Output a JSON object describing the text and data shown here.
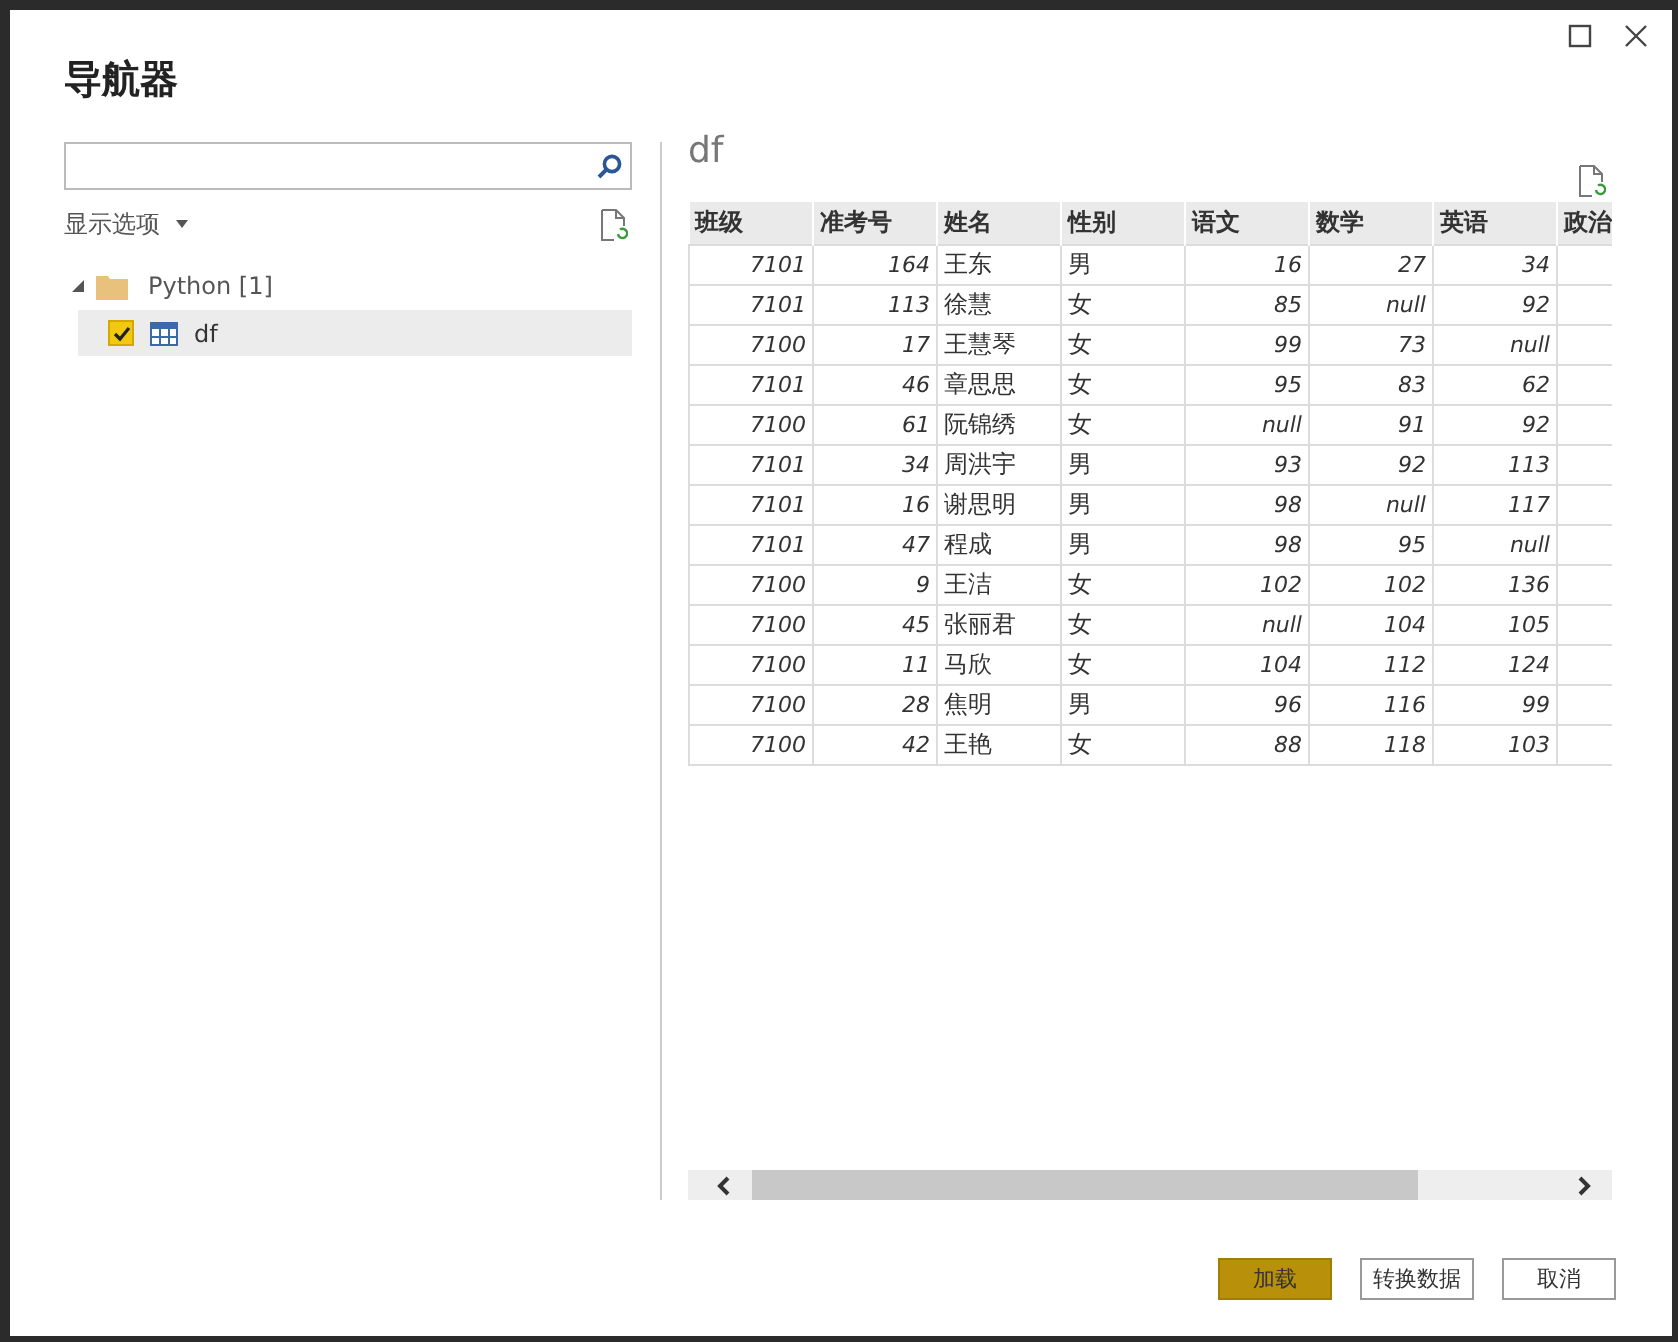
{
  "window": {
    "title": "导航器"
  },
  "display_options": {
    "label": "显示选项"
  },
  "tree": [
    {
      "label": "Python [1]",
      "expanded": true,
      "children": [
        {
          "label": "df",
          "checked": true,
          "selected": true
        }
      ]
    }
  ],
  "preview": {
    "title": "df",
    "columns": [
      {
        "label": "班级",
        "kind": "number"
      },
      {
        "label": "准考号",
        "kind": "number"
      },
      {
        "label": "姓名",
        "kind": "text"
      },
      {
        "label": "性别",
        "kind": "text"
      },
      {
        "label": "语文",
        "kind": "number"
      },
      {
        "label": "数学",
        "kind": "number"
      },
      {
        "label": "英语",
        "kind": "number"
      },
      {
        "label": "政治",
        "kind": "text"
      }
    ],
    "rows": [
      [
        "7101",
        "164",
        "王东",
        "男",
        "16",
        "27",
        "34"
      ],
      [
        "7101",
        "113",
        "徐慧",
        "女",
        "85",
        "null",
        "92"
      ],
      [
        "7100",
        "17",
        "王慧琴",
        "女",
        "99",
        "73",
        "null"
      ],
      [
        "7101",
        "46",
        "章思思",
        "女",
        "95",
        "83",
        "62"
      ],
      [
        "7100",
        "61",
        "阮锦绣",
        "女",
        "null",
        "91",
        "92"
      ],
      [
        "7101",
        "34",
        "周洪宇",
        "男",
        "93",
        "92",
        "113"
      ],
      [
        "7101",
        "16",
        "谢思明",
        "男",
        "98",
        "null",
        "117"
      ],
      [
        "7101",
        "47",
        "程成",
        "男",
        "98",
        "95",
        "null"
      ],
      [
        "7100",
        "9",
        "王洁",
        "女",
        "102",
        "102",
        "136"
      ],
      [
        "7100",
        "45",
        "张丽君",
        "女",
        "null",
        "104",
        "105"
      ],
      [
        "7100",
        "11",
        "马欣",
        "女",
        "104",
        "112",
        "124"
      ],
      [
        "7100",
        "28",
        "焦明",
        "男",
        "96",
        "116",
        "99"
      ],
      [
        "7100",
        "42",
        "王艳",
        "女",
        "88",
        "118",
        "103"
      ]
    ]
  },
  "buttons": [
    {
      "label": "加载",
      "kind": "primary"
    },
    {
      "label": "转换数据",
      "kind": "default"
    },
    {
      "label": "取消",
      "kind": "default"
    }
  ]
}
